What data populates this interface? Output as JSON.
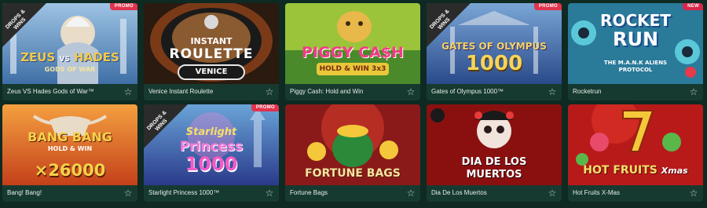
{
  "games": [
    {
      "title": "Zeus VS Hades Gods of War™",
      "badge": "PROMO",
      "drops": "DROPS & WINS",
      "logo": [
        "ZEUS",
        "HADES",
        "GODS OF WAR"
      ]
    },
    {
      "title": "Venice Instant Roulette",
      "logo": [
        "INSTANT",
        "ROULETTE",
        "VENICE"
      ]
    },
    {
      "title": "Piggy Cash: Hold and Win",
      "logo": [
        "PIGGY CA$H",
        "HOLD & WIN 3x3"
      ]
    },
    {
      "title": "Gates of Olympus 1000™",
      "badge": "PROMO",
      "drops": "DROPS & WINS",
      "logo": [
        "GATES OF OLYMPUS",
        "1000"
      ]
    },
    {
      "title": "Rocketrun",
      "badge": "NEW",
      "logo": [
        "ROCKET",
        "RUN",
        "THE M.A.N.K ALIENS PROTOCOL"
      ]
    },
    {
      "title": "Bang! Bang!",
      "logo": [
        "BANG BANG",
        "HOLD & WIN",
        "×26000"
      ]
    },
    {
      "title": "Starlight Princess 1000™",
      "badge": "PROMO",
      "drops": "DROPS & WINS",
      "logo": [
        "Starlight",
        "Princess",
        "1000"
      ]
    },
    {
      "title": "Fortune Bags",
      "logo": [
        "FORTUNE BAGS"
      ]
    },
    {
      "title": "Dia De Los Muertos",
      "logo": [
        "DIA DE LOS",
        "MUERTOS"
      ]
    },
    {
      "title": "Hot Fruits X-Mas",
      "logo": [
        "HOT FRUITS",
        "Xmas"
      ]
    }
  ],
  "icons": {
    "favorite": "star-outline-icon",
    "drops": "crown-icon"
  },
  "colors": {
    "background": "#0e2a22",
    "card": "#173a30",
    "promo": "#e0334c",
    "new": "#d8264b"
  }
}
